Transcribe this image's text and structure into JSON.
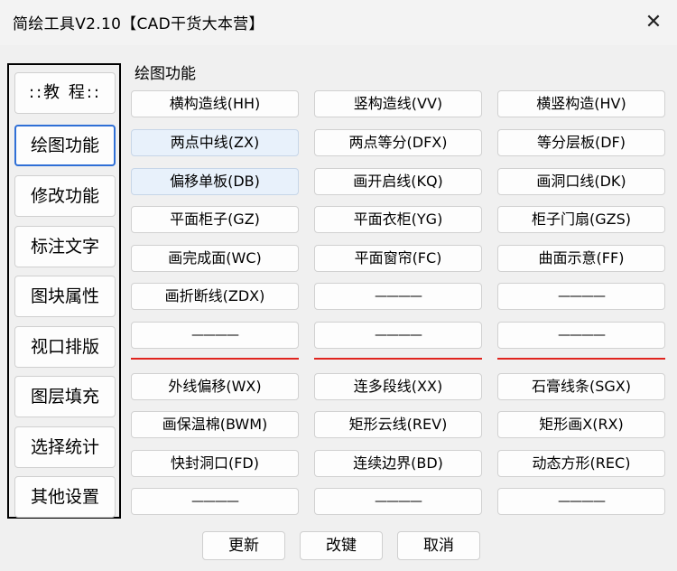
{
  "window": {
    "title": "简绘工具V2.10【CAD干货大本营】",
    "close_glyph": "✕"
  },
  "sidebar": {
    "items": [
      {
        "label": "::教 程::"
      },
      {
        "label": "绘图功能"
      },
      {
        "label": "修改功能"
      },
      {
        "label": "标注文字"
      },
      {
        "label": "图块属性"
      },
      {
        "label": "视口排版"
      },
      {
        "label": "图层填充"
      },
      {
        "label": "选择统计"
      },
      {
        "label": "其他设置"
      }
    ],
    "active_index": 1
  },
  "main": {
    "section_title": "绘图功能",
    "buttons": [
      "横构造线(HH)",
      "竖构造线(VV)",
      "横竖构造(HV)",
      "两点中线(ZX)",
      "两点等分(DFX)",
      "等分层板(DF)",
      "偏移单板(DB)",
      "画开启线(KQ)",
      "画洞口线(DK)",
      "平面柜子(GZ)",
      "平面衣柜(YG)",
      "柜子门扇(GZS)",
      "画完成面(WC)",
      "平面窗帘(FC)",
      "曲面示意(FF)",
      "画折断线(ZDX)",
      "————",
      "————",
      "————",
      "————",
      "————",
      "外线偏移(WX)",
      "连多段线(XX)",
      "石膏线条(SGX)",
      "画保温棉(BWM)",
      "矩形云线(REV)",
      "矩形画X(RX)",
      "快封洞口(FD)",
      "连续边界(BD)",
      "动态方形(REC)",
      "————",
      "————",
      "————"
    ]
  },
  "footer": {
    "update": "更新",
    "rekey": "改键",
    "cancel": "取消"
  },
  "colors": {
    "separator": "#e0241e",
    "active_border": "#2f6fd6",
    "highlight_bg": "#e8f1fb"
  }
}
